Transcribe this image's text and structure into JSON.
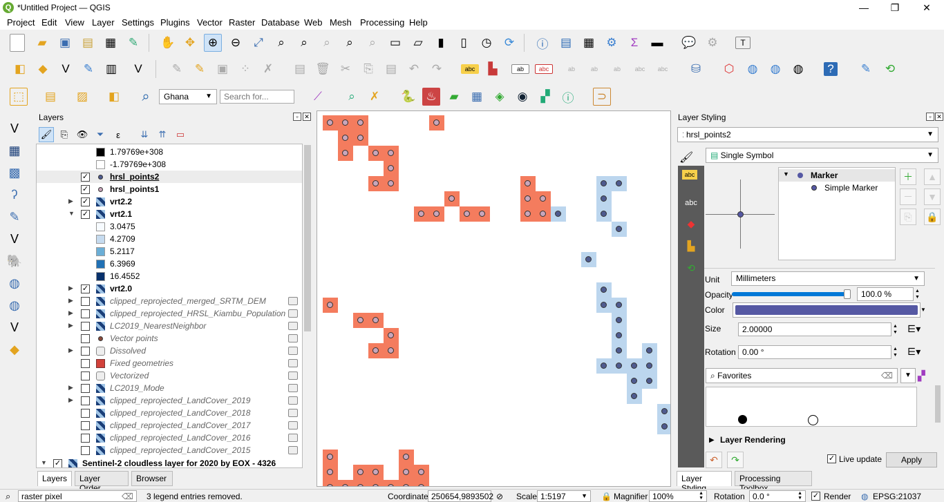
{
  "window": {
    "title": "*Untitled Project — QGIS",
    "min": "—",
    "max": "❐",
    "close": "✕"
  },
  "menu": [
    "Project",
    "Edit",
    "View",
    "Layer",
    "Settings",
    "Plugins",
    "Vector",
    "Raster",
    "Database",
    "Web",
    "Mesh",
    "Processing",
    "Help"
  ],
  "toolbar3": {
    "locator_country": "Ghana",
    "search_placeholder": "Search for..."
  },
  "layers_panel": {
    "title": "Layers",
    "rows": [
      {
        "label": "1.79769e+308",
        "kind": "legend",
        "swatch": "#000000"
      },
      {
        "label": "-1.79769e+308",
        "kind": "legend",
        "swatch": "#ffffff"
      },
      {
        "label": "hrsl_points2",
        "kind": "layer",
        "checked": true,
        "bold": true,
        "underline": true,
        "icon": "point-blue"
      },
      {
        "label": "hrsl_points1",
        "kind": "layer",
        "checked": true,
        "bold": true,
        "icon": "point-pink"
      },
      {
        "label": "vrt2.2",
        "kind": "layer",
        "checked": true,
        "bold": true,
        "expand": "▶",
        "icon": "raster"
      },
      {
        "label": "vrt2.1",
        "kind": "layer",
        "checked": true,
        "bold": true,
        "expand": "▼",
        "icon": "raster"
      },
      {
        "label": "3.0475",
        "kind": "legend",
        "swatch": "#f7fbff"
      },
      {
        "label": "4.2709",
        "kind": "legend",
        "swatch": "#c6dbef"
      },
      {
        "label": "5.2117",
        "kind": "legend",
        "swatch": "#6baed6"
      },
      {
        "label": "6.3969",
        "kind": "legend",
        "swatch": "#2171b5"
      },
      {
        "label": "16.4552",
        "kind": "legend",
        "swatch": "#08306b"
      },
      {
        "label": "vrt2.0",
        "kind": "layer",
        "checked": true,
        "bold": true,
        "expand": "▶",
        "icon": "raster"
      },
      {
        "label": "clipped_reprojected_merged_SRTM_DEM",
        "kind": "layer",
        "checked": false,
        "italic": true,
        "expand": "▶",
        "icon": "raster",
        "embedded": true
      },
      {
        "label": "clipped_reprojected_HRSL_Kiambu_Population",
        "kind": "layer",
        "checked": false,
        "italic": true,
        "expand": "▶",
        "icon": "raster",
        "embedded": true
      },
      {
        "label": "LC2019_NearestNeighbor",
        "kind": "layer",
        "checked": false,
        "italic": true,
        "expand": "▶",
        "icon": "raster",
        "embedded": true
      },
      {
        "label": "Vector points",
        "kind": "layer",
        "checked": false,
        "italic": true,
        "icon": "point-brown",
        "embedded": true
      },
      {
        "label": "Dissolved",
        "kind": "layer",
        "checked": false,
        "italic": true,
        "expand": "▶",
        "icon": "polygon-outline",
        "embedded": true
      },
      {
        "label": "Fixed geometries",
        "kind": "layer",
        "checked": false,
        "italic": true,
        "icon": "polygon-red",
        "embedded": true
      },
      {
        "label": "Vectorized",
        "kind": "layer",
        "checked": false,
        "italic": true,
        "icon": "polygon-outline",
        "embedded": true
      },
      {
        "label": "LC2019_Mode",
        "kind": "layer",
        "checked": false,
        "italic": true,
        "expand": "▶",
        "icon": "raster",
        "embedded": true
      },
      {
        "label": "clipped_reprojected_LandCover_2019",
        "kind": "layer",
        "checked": false,
        "italic": true,
        "expand": "▶",
        "icon": "raster",
        "embedded": true
      },
      {
        "label": "clipped_reprojected_LandCover_2018",
        "kind": "layer",
        "checked": false,
        "italic": true,
        "icon": "raster",
        "embedded": true
      },
      {
        "label": "clipped_reprojected_LandCover_2017",
        "kind": "layer",
        "checked": false,
        "italic": true,
        "icon": "raster",
        "embedded": true
      },
      {
        "label": "clipped_reprojected_LandCover_2016",
        "kind": "layer",
        "checked": false,
        "italic": true,
        "icon": "raster",
        "embedded": true
      },
      {
        "label": "clipped_reprojected_LandCover_2015",
        "kind": "layer",
        "checked": false,
        "italic": true,
        "icon": "raster",
        "embedded": true
      }
    ],
    "group_row": {
      "label": "Sentinel-2 cloudless layer for 2020 by EOX - 4326",
      "checked": true,
      "expand": "▼"
    },
    "tabs": [
      "Layers",
      "Layer Order",
      "Browser"
    ]
  },
  "layer_styling": {
    "title": "Layer Styling",
    "layer": "hrsl_points2",
    "renderer": "Single Symbol",
    "tree": {
      "marker": "Marker",
      "simple_marker": "Simple Marker"
    },
    "unit_label": "Unit",
    "unit": "Millimeters",
    "opacity_label": "Opacity",
    "opacity": "100.0 %",
    "opacity_level": 1.0,
    "color_label": "Color",
    "color": "#5558a3",
    "size_label": "Size",
    "size": "2.00000",
    "rotation_label": "Rotation",
    "rotation": "0.00 °",
    "favorites": "Favorites",
    "layer_rendering": "Layer Rendering",
    "live_update": "Live update",
    "apply": "Apply",
    "tabs": [
      "Layer Styling",
      "Processing Toolbox"
    ]
  },
  "statusbar": {
    "search_value": "raster pixel",
    "message": "3 legend entries removed.",
    "coordinate_label": "Coordinate",
    "coordinate": "250654,9893502",
    "scale_label": "Scale",
    "scale": "1:5197",
    "magnifier_label": "Magnifier",
    "magnifier": "100%",
    "rotation_label": "Rotation",
    "rotation": "0.0 °",
    "render_label": "Render",
    "crs": "EPSG:21037"
  },
  "colors": {
    "pixel_red": "#f47c5e",
    "pixel_blue": "#bcd6ee",
    "accent": "#0078d7"
  }
}
